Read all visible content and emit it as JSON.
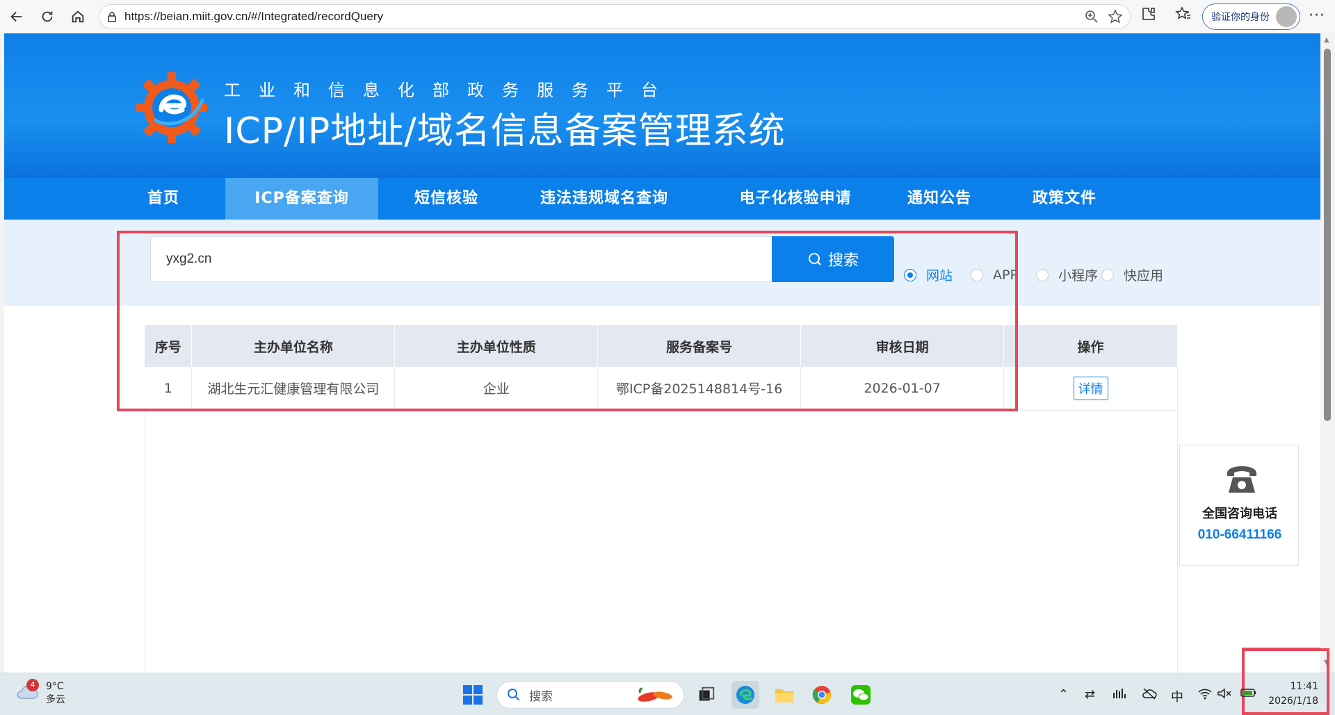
{
  "browser": {
    "url": "https://beian.miit.gov.cn/#/Integrated/recordQuery",
    "profile_label": "验证你的身份",
    "more_label": "···"
  },
  "header": {
    "subtitle": "工业和信息化部政务服务平台",
    "title": "ICP/IP地址/域名信息备案管理系统"
  },
  "nav": {
    "items": [
      {
        "label": "首页"
      },
      {
        "label": "ICP备案查询"
      },
      {
        "label": "短信核验"
      },
      {
        "label": "违法违规域名查询"
      },
      {
        "label": "电子化核验申请"
      },
      {
        "label": "通知公告"
      },
      {
        "label": "政策文件"
      }
    ],
    "active_index": 1
  },
  "search": {
    "value": "yxg2.cn",
    "button_label": "搜索",
    "types": [
      {
        "label": "网站",
        "checked": true
      },
      {
        "label": "APP",
        "checked": false
      },
      {
        "label": "小程序",
        "checked": false
      },
      {
        "label": "快应用",
        "checked": false
      }
    ]
  },
  "table": {
    "headers": [
      "序号",
      "主办单位名称",
      "主办单位性质",
      "服务备案号",
      "审核日期",
      "操作"
    ],
    "rows": [
      {
        "index": "1",
        "org_name": "湖北生元汇健康管理有限公司",
        "org_type": "企业",
        "record_no": "鄂ICP备2025148814号-16",
        "date": "2026-01-07",
        "action": "详情"
      }
    ]
  },
  "consult": {
    "title": "全国咨询电话",
    "phone": "010-66411166"
  },
  "taskbar": {
    "weather_badge": "4",
    "temperature": "9°C",
    "condition": "多云",
    "search_label": "搜索",
    "ime": "中",
    "time": "11:41",
    "date": "2026/1/18"
  },
  "colors": {
    "brand_blue": "#0b80ea",
    "highlight_red": "#e5485a"
  }
}
